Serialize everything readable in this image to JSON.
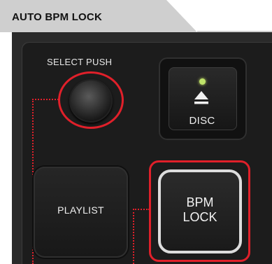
{
  "header": {
    "title": "AUTO BPM LOCK"
  },
  "controls": {
    "select_push": {
      "label": "SELECT PUSH",
      "icon": "rotary-knob-icon"
    },
    "disc": {
      "label": "DISC",
      "icon": "eject-icon",
      "led_color": "#bfe36a"
    },
    "playlist": {
      "label": "PLAYLIST"
    },
    "bpm_lock": {
      "label_line1": "BPM",
      "label_line2": "LOCK"
    }
  },
  "colors": {
    "highlight": "#e0202a",
    "panel": "#1c1c1c",
    "tab": "#cfcfcf"
  }
}
